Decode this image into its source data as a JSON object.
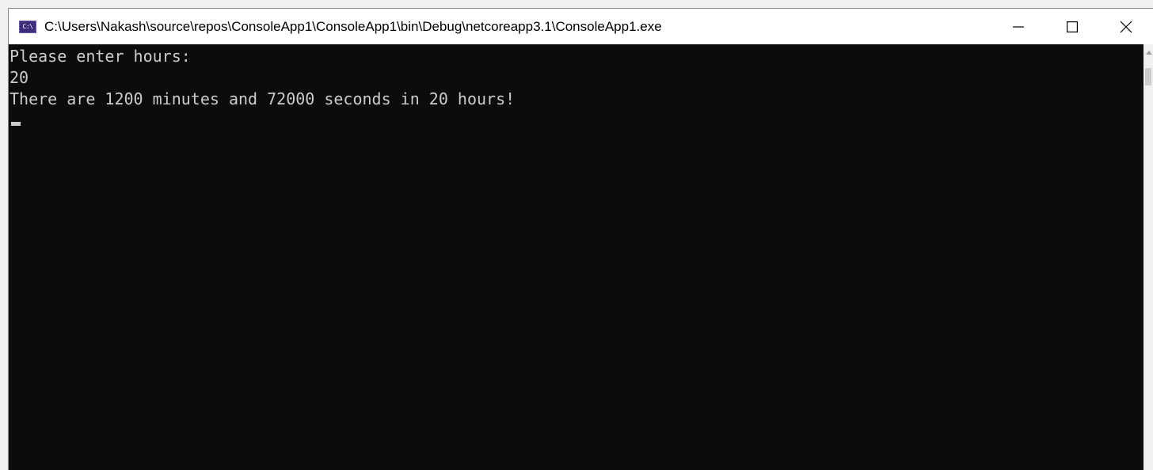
{
  "window": {
    "icon_text": "C:\\",
    "title": "C:\\Users\\Nakash\\source\\repos\\ConsoleApp1\\ConsoleApp1\\bin\\Debug\\netcoreapp3.1\\ConsoleApp1.exe"
  },
  "controls": {
    "minimize_icon": "minimize-icon",
    "maximize_icon": "maximize-icon",
    "close_icon": "close-icon"
  },
  "console": {
    "lines": [
      "Please enter hours:",
      "20",
      "There are 1200 minutes and 72000 seconds in 20 hours!"
    ]
  },
  "colors": {
    "console_background": "#0c0c0c",
    "console_text": "#cccccc",
    "titlebar_background": "#ffffff"
  }
}
